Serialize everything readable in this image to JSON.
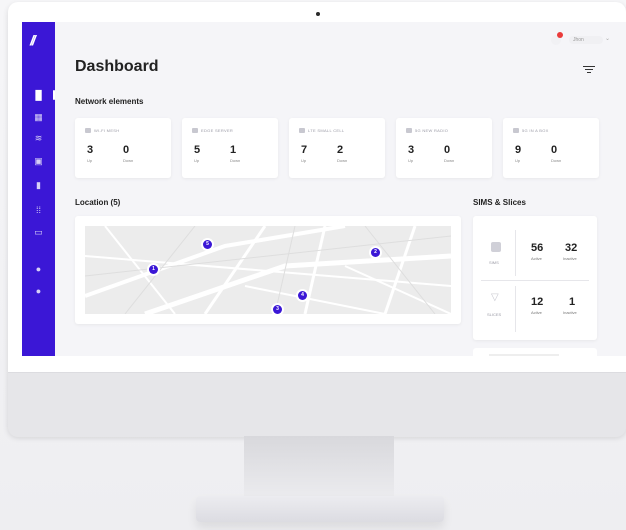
{
  "header": {
    "page_title": "Dashboard",
    "user_name": "Jhon"
  },
  "sections": {
    "network_elements": "Network elements",
    "location": "Location (5)",
    "sims_slices": "SIMS & Slices"
  },
  "network_elements": [
    {
      "label": "Wi-Fi Mesh",
      "up": "3",
      "down": "0",
      "up_label": "Up",
      "down_label": "Down",
      "icon": "wifi-mesh-icon"
    },
    {
      "label": "Edge Server",
      "up": "5",
      "down": "1",
      "up_label": "Up",
      "down_label": "Down",
      "icon": "server-icon"
    },
    {
      "label": "LTE Small Cell",
      "up": "7",
      "down": "2",
      "up_label": "Up",
      "down_label": "Down",
      "icon": "signal-icon"
    },
    {
      "label": "5G New Radio",
      "up": "3",
      "down": "0",
      "up_label": "Up",
      "down_label": "Down",
      "icon": "radio-icon"
    },
    {
      "label": "5G in a Box",
      "up": "9",
      "down": "0",
      "up_label": "Up",
      "down_label": "Down",
      "icon": "box-icon"
    }
  ],
  "map_pins": [
    "1",
    "5",
    "4",
    "2",
    "3"
  ],
  "sims": {
    "label": "SIMS",
    "active": "56",
    "inactive": "32",
    "active_label": "Active",
    "inactive_label": "Inactive"
  },
  "slices": {
    "label": "SLICES",
    "active": "12",
    "inactive": "1",
    "active_label": "Active",
    "inactive_label": "Inactive"
  },
  "colors": {
    "accent": "#3b17d6",
    "notification": "#ea3b3b"
  }
}
